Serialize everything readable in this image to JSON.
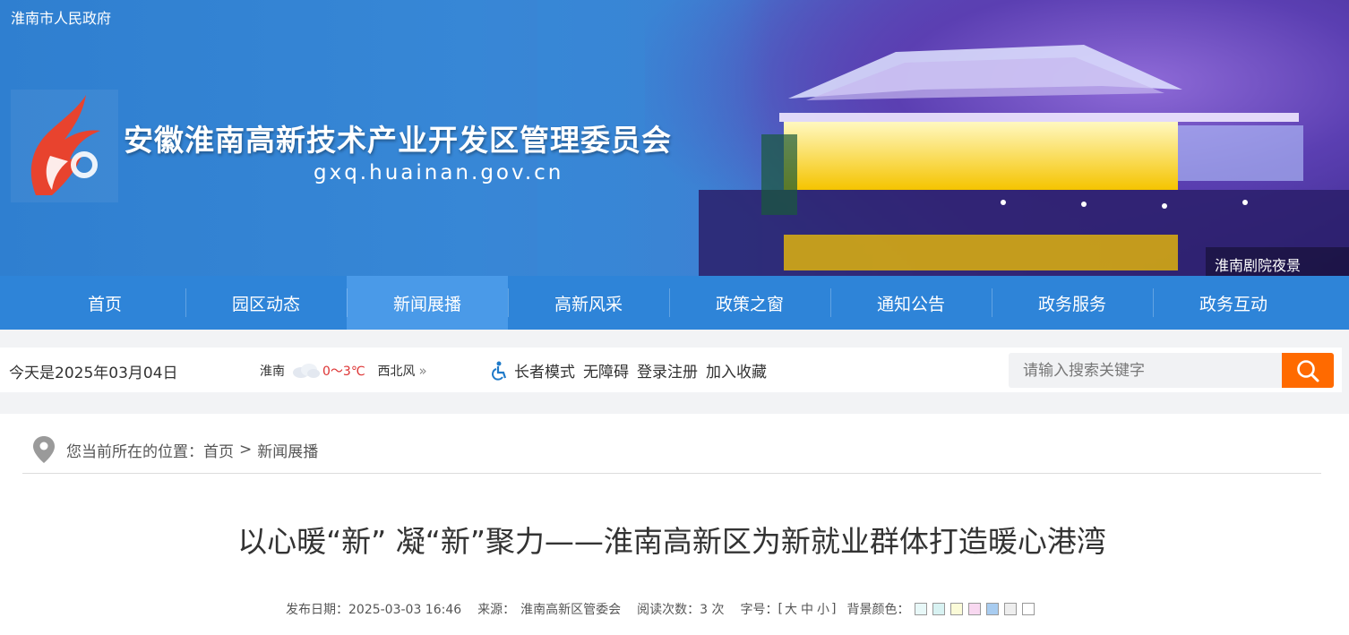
{
  "banner": {
    "site_tag": "淮南市人民政府",
    "org_name": "安徽淮南高新技术产业开发区管理委员会",
    "domain": "gxq.huainan.gov.cn",
    "caption": "淮南剧院夜景",
    "logo_color": "#e8432e"
  },
  "nav": {
    "items": [
      {
        "label": "首页"
      },
      {
        "label": "园区动态"
      },
      {
        "label": "新闻展播",
        "active": true
      },
      {
        "label": "高新风采"
      },
      {
        "label": "政策之窗"
      },
      {
        "label": "通知公告"
      },
      {
        "label": "政务服务"
      },
      {
        "label": "政务互动"
      }
    ],
    "color": "#2e84d8",
    "active_color": "#4a9ae8"
  },
  "infobar": {
    "date": "今天是2025年03月04日",
    "weather": {
      "city": "淮南",
      "icon": "cloud-icon",
      "temp": "0～3℃",
      "wind": "西北风"
    },
    "tools": {
      "elder_mode": "长者模式",
      "accessibility": "无障碍",
      "login": "登录注册",
      "favorite": "加入收藏"
    },
    "search": {
      "placeholder": "请输入搜索关键字",
      "button_color": "#ff6a00"
    }
  },
  "breadcrumb": {
    "prefix": "您当前所在的位置：",
    "home": "首页",
    "separator": ">",
    "current": "新闻展播"
  },
  "article": {
    "title": "以心暖“新” 凝“新”聚力——淮南高新区为新就业群体打造暖心港湾",
    "publish_date": "发布日期：2025-03-03 16:46",
    "source_label": "来源：",
    "source": "淮南高新区管委会",
    "views": "阅读次数：3 次",
    "font_label": "字号：",
    "font_open": "[",
    "font_large": "大",
    "font_medium": "中",
    "font_small": "小",
    "font_close": "]",
    "bg_label": "背景颜色：",
    "bg_colors": [
      "#e8f8f8",
      "#d8f2f2",
      "#fbfbd8",
      "#f8d8f0",
      "#a8ccf0",
      "#eeeeee",
      "#ffffff"
    ]
  }
}
